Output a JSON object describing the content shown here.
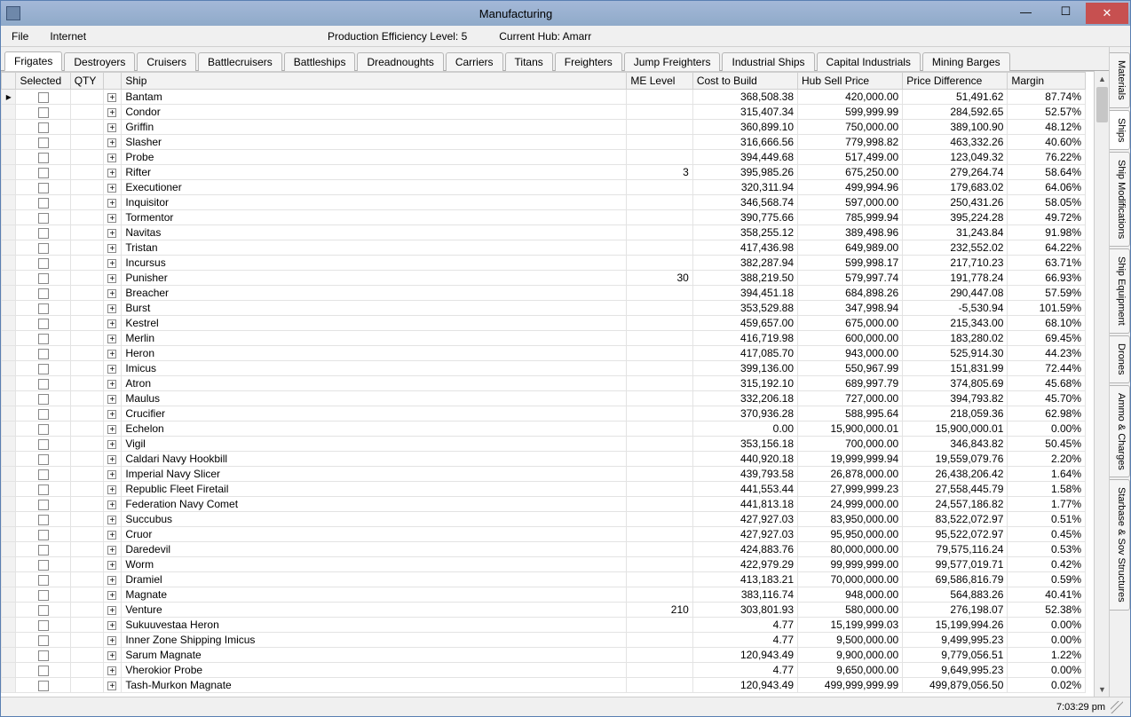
{
  "window": {
    "title": "Manufacturing"
  },
  "menu": {
    "file": "File",
    "internet": "Internet",
    "efficiency": "Production Efficiency Level: 5",
    "hub": "Current Hub: Amarr"
  },
  "top_tabs": [
    "Frigates",
    "Destroyers",
    "Cruisers",
    "Battlecruisers",
    "Battleships",
    "Dreadnoughts",
    "Carriers",
    "Titans",
    "Freighters",
    "Jump Freighters",
    "Industrial Ships",
    "Capital Industrials",
    "Mining Barges"
  ],
  "top_tab_active": 0,
  "side_tabs": [
    "Materials",
    "Ships",
    "Ship Modifications",
    "Ship Equipment",
    "Drones",
    "Ammo & Charges",
    "Starbase & Sov Structures"
  ],
  "side_tab_active": 1,
  "columns": {
    "selected": "Selected",
    "qty": "QTY",
    "ship": "Ship",
    "me": "ME Level",
    "cost": "Cost to Build",
    "hub": "Hub Sell Price",
    "diff": "Price Difference",
    "margin": "Margin"
  },
  "rows": [
    {
      "ship": "Bantam",
      "me": "",
      "cost": "368,508.38",
      "hub": "420,000.00",
      "diff": "51,491.62",
      "margin": "87.74%"
    },
    {
      "ship": "Condor",
      "me": "",
      "cost": "315,407.34",
      "hub": "599,999.99",
      "diff": "284,592.65",
      "margin": "52.57%"
    },
    {
      "ship": "Griffin",
      "me": "",
      "cost": "360,899.10",
      "hub": "750,000.00",
      "diff": "389,100.90",
      "margin": "48.12%"
    },
    {
      "ship": "Slasher",
      "me": "",
      "cost": "316,666.56",
      "hub": "779,998.82",
      "diff": "463,332.26",
      "margin": "40.60%"
    },
    {
      "ship": "Probe",
      "me": "",
      "cost": "394,449.68",
      "hub": "517,499.00",
      "diff": "123,049.32",
      "margin": "76.22%"
    },
    {
      "ship": "Rifter",
      "me": "3",
      "cost": "395,985.26",
      "hub": "675,250.00",
      "diff": "279,264.74",
      "margin": "58.64%"
    },
    {
      "ship": "Executioner",
      "me": "",
      "cost": "320,311.94",
      "hub": "499,994.96",
      "diff": "179,683.02",
      "margin": "64.06%"
    },
    {
      "ship": "Inquisitor",
      "me": "",
      "cost": "346,568.74",
      "hub": "597,000.00",
      "diff": "250,431.26",
      "margin": "58.05%"
    },
    {
      "ship": "Tormentor",
      "me": "",
      "cost": "390,775.66",
      "hub": "785,999.94",
      "diff": "395,224.28",
      "margin": "49.72%"
    },
    {
      "ship": "Navitas",
      "me": "",
      "cost": "358,255.12",
      "hub": "389,498.96",
      "diff": "31,243.84",
      "margin": "91.98%"
    },
    {
      "ship": "Tristan",
      "me": "",
      "cost": "417,436.98",
      "hub": "649,989.00",
      "diff": "232,552.02",
      "margin": "64.22%"
    },
    {
      "ship": "Incursus",
      "me": "",
      "cost": "382,287.94",
      "hub": "599,998.17",
      "diff": "217,710.23",
      "margin": "63.71%"
    },
    {
      "ship": "Punisher",
      "me": "30",
      "cost": "388,219.50",
      "hub": "579,997.74",
      "diff": "191,778.24",
      "margin": "66.93%"
    },
    {
      "ship": "Breacher",
      "me": "",
      "cost": "394,451.18",
      "hub": "684,898.26",
      "diff": "290,447.08",
      "margin": "57.59%"
    },
    {
      "ship": "Burst",
      "me": "",
      "cost": "353,529.88",
      "hub": "347,998.94",
      "diff": "-5,530.94",
      "margin": "101.59%"
    },
    {
      "ship": "Kestrel",
      "me": "",
      "cost": "459,657.00",
      "hub": "675,000.00",
      "diff": "215,343.00",
      "margin": "68.10%"
    },
    {
      "ship": "Merlin",
      "me": "",
      "cost": "416,719.98",
      "hub": "600,000.00",
      "diff": "183,280.02",
      "margin": "69.45%"
    },
    {
      "ship": "Heron",
      "me": "",
      "cost": "417,085.70",
      "hub": "943,000.00",
      "diff": "525,914.30",
      "margin": "44.23%"
    },
    {
      "ship": "Imicus",
      "me": "",
      "cost": "399,136.00",
      "hub": "550,967.99",
      "diff": "151,831.99",
      "margin": "72.44%"
    },
    {
      "ship": "Atron",
      "me": "",
      "cost": "315,192.10",
      "hub": "689,997.79",
      "diff": "374,805.69",
      "margin": "45.68%"
    },
    {
      "ship": "Maulus",
      "me": "",
      "cost": "332,206.18",
      "hub": "727,000.00",
      "diff": "394,793.82",
      "margin": "45.70%"
    },
    {
      "ship": "Crucifier",
      "me": "",
      "cost": "370,936.28",
      "hub": "588,995.64",
      "diff": "218,059.36",
      "margin": "62.98%"
    },
    {
      "ship": "Echelon",
      "me": "",
      "cost": "0.00",
      "hub": "15,900,000.01",
      "diff": "15,900,000.01",
      "margin": "0.00%"
    },
    {
      "ship": "Vigil",
      "me": "",
      "cost": "353,156.18",
      "hub": "700,000.00",
      "diff": "346,843.82",
      "margin": "50.45%"
    },
    {
      "ship": "Caldari Navy Hookbill",
      "me": "",
      "cost": "440,920.18",
      "hub": "19,999,999.94",
      "diff": "19,559,079.76",
      "margin": "2.20%"
    },
    {
      "ship": "Imperial Navy Slicer",
      "me": "",
      "cost": "439,793.58",
      "hub": "26,878,000.00",
      "diff": "26,438,206.42",
      "margin": "1.64%"
    },
    {
      "ship": "Republic Fleet Firetail",
      "me": "",
      "cost": "441,553.44",
      "hub": "27,999,999.23",
      "diff": "27,558,445.79",
      "margin": "1.58%"
    },
    {
      "ship": "Federation Navy Comet",
      "me": "",
      "cost": "441,813.18",
      "hub": "24,999,000.00",
      "diff": "24,557,186.82",
      "margin": "1.77%"
    },
    {
      "ship": "Succubus",
      "me": "",
      "cost": "427,927.03",
      "hub": "83,950,000.00",
      "diff": "83,522,072.97",
      "margin": "0.51%"
    },
    {
      "ship": "Cruor",
      "me": "",
      "cost": "427,927.03",
      "hub": "95,950,000.00",
      "diff": "95,522,072.97",
      "margin": "0.45%"
    },
    {
      "ship": "Daredevil",
      "me": "",
      "cost": "424,883.76",
      "hub": "80,000,000.00",
      "diff": "79,575,116.24",
      "margin": "0.53%"
    },
    {
      "ship": "Worm",
      "me": "",
      "cost": "422,979.29",
      "hub": "99,999,999.00",
      "diff": "99,577,019.71",
      "margin": "0.42%"
    },
    {
      "ship": "Dramiel",
      "me": "",
      "cost": "413,183.21",
      "hub": "70,000,000.00",
      "diff": "69,586,816.79",
      "margin": "0.59%"
    },
    {
      "ship": "Magnate",
      "me": "",
      "cost": "383,116.74",
      "hub": "948,000.00",
      "diff": "564,883.26",
      "margin": "40.41%"
    },
    {
      "ship": "Venture",
      "me": "210",
      "cost": "303,801.93",
      "hub": "580,000.00",
      "diff": "276,198.07",
      "margin": "52.38%"
    },
    {
      "ship": "Sukuuvestaa Heron",
      "me": "",
      "cost": "4.77",
      "hub": "15,199,999.03",
      "diff": "15,199,994.26",
      "margin": "0.00%"
    },
    {
      "ship": "Inner Zone Shipping Imicus",
      "me": "",
      "cost": "4.77",
      "hub": "9,500,000.00",
      "diff": "9,499,995.23",
      "margin": "0.00%"
    },
    {
      "ship": "Sarum Magnate",
      "me": "",
      "cost": "120,943.49",
      "hub": "9,900,000.00",
      "diff": "9,779,056.51",
      "margin": "1.22%"
    },
    {
      "ship": "Vherokior Probe",
      "me": "",
      "cost": "4.77",
      "hub": "9,650,000.00",
      "diff": "9,649,995.23",
      "margin": "0.00%"
    },
    {
      "ship": "Tash-Murkon Magnate",
      "me": "",
      "cost": "120,943.49",
      "hub": "499,999,999.99",
      "diff": "499,879,056.50",
      "margin": "0.02%"
    }
  ],
  "status": {
    "time": "7:03:29 pm"
  }
}
